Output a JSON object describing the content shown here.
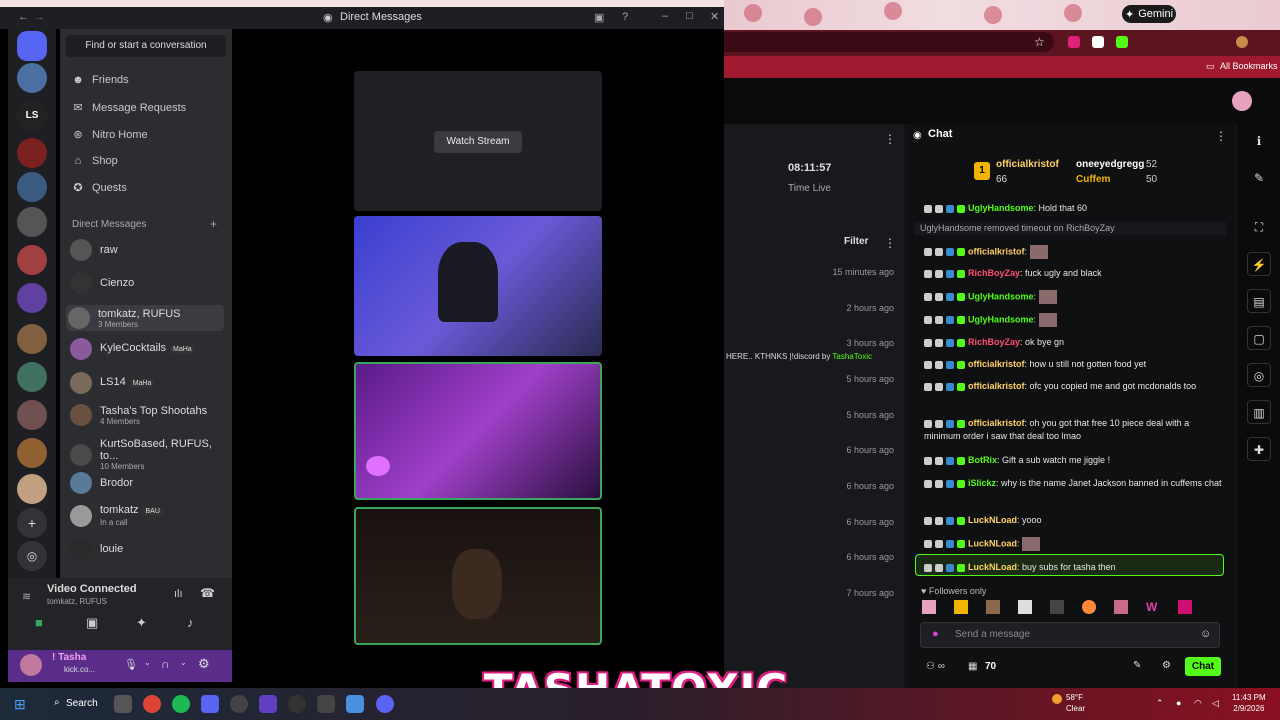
{
  "browser": {
    "gemini_label": "Gemini",
    "bookmarks_label": "All Bookmarks"
  },
  "discord": {
    "title": "Direct Messages",
    "find_placeholder": "Find or start a conversation",
    "nav": [
      {
        "label": "Friends",
        "icon": "friends-icon"
      },
      {
        "label": "Message Requests",
        "icon": "envelope-icon"
      },
      {
        "label": "Nitro Home",
        "icon": "nitro-icon"
      },
      {
        "label": "Shop",
        "icon": "shop-icon"
      },
      {
        "label": "Quests",
        "icon": "quests-icon"
      }
    ],
    "dm_header": "Direct Messages",
    "dms": [
      {
        "name": "raw",
        "sub": "",
        "tag": ""
      },
      {
        "name": "Cienzo",
        "sub": "",
        "tag": ""
      },
      {
        "name": "tomkatz, RUFUS",
        "sub": "3 Members",
        "tag": ""
      },
      {
        "name": "KyleCocktails",
        "sub": "",
        "tag": "MaHa"
      },
      {
        "name": "LS14",
        "sub": "",
        "tag": "MaHa"
      },
      {
        "name": "Tasha's Top Shootahs",
        "sub": "4 Members",
        "tag": ""
      },
      {
        "name": "KurtSoBased, RUFUS, to...",
        "sub": "10 Members",
        "tag": ""
      },
      {
        "name": "Brodor",
        "sub": "",
        "tag": ""
      },
      {
        "name": "tomkatz",
        "sub": "In a call",
        "tag": "BAU"
      },
      {
        "name": "louie",
        "sub": "",
        "tag": ""
      }
    ],
    "voice_status": "Video Connected",
    "voice_channel": "tomkatz, RUFUS",
    "user_name": "! Tasha",
    "user_status": "kick.co...",
    "watch_stream": "Watch Stream"
  },
  "site": {
    "timer": "08:11:57",
    "timer_label": "Time Live",
    "filter_label": "Filter",
    "ago": [
      "15 minutes ago",
      "2 hours ago",
      "3 hours ago",
      "5 hours ago",
      "5 hours ago",
      "6 hours ago",
      "6 hours ago",
      "6 hours ago",
      "6 hours ago",
      "7 hours ago"
    ],
    "banner_text": "HERE.. KTHNKS |!discord by",
    "banner_user": "TashaToxic"
  },
  "chat": {
    "title": "Chat",
    "leaders": {
      "first": {
        "rank": "1",
        "name": "officialkristof",
        "count": "66"
      },
      "second": {
        "name": "oneeyedgregg",
        "count": "52"
      },
      "third": {
        "name": "Cuffem",
        "count": "50"
      }
    },
    "lines": [
      {
        "user": "UglyHandsome",
        "color": "#53fc18",
        "text": "Hold that 60"
      },
      {
        "user": "",
        "color": "#aaa",
        "text": "UglyHandsome removed timeout on RichBoyZay"
      },
      {
        "user": "officialkristof",
        "color": "#ffd166",
        "text": ""
      },
      {
        "user": "RichBoyZay",
        "color": "#ff4d6d",
        "text": "fuck ugly and black"
      },
      {
        "user": "UglyHandsome",
        "color": "#53fc18",
        "text": ""
      },
      {
        "user": "UglyHandsome",
        "color": "#53fc18",
        "text": ""
      },
      {
        "user": "RichBoyZay",
        "color": "#ff4d6d",
        "text": "ok bye gn"
      },
      {
        "user": "officialkristof",
        "color": "#ffd166",
        "text": "how u still not gotten food yet"
      },
      {
        "user": "officialkristof",
        "color": "#ffd166",
        "text": "ofc you copied me and got mcdonalds too"
      },
      {
        "user": "officialkristof",
        "color": "#ffd166",
        "text": "oh you got that free 10 piece deal with a minimum order i saw that deal too lmao"
      },
      {
        "user": "BotRix",
        "color": "#53fc18",
        "text": "Gift a sub watch me jiggle !"
      },
      {
        "user": "iSlickz",
        "color": "#53fc18",
        "text": "why is the name Janet Jackson banned in cuffems chat"
      },
      {
        "user": "LuckNLoad",
        "color": "#ffd166",
        "text": "yooo"
      },
      {
        "user": "LuckNLoad",
        "color": "#ffd166",
        "text": ""
      },
      {
        "user": "LuckNLoad",
        "color": "#ffd166",
        "text": "buy subs for tasha then"
      }
    ],
    "followers_only": "Followers only",
    "send_placeholder": "Send a message",
    "viewer_count": "70",
    "chat_button": "Chat"
  },
  "taskbar": {
    "search": "Search",
    "weather_temp": "58°F",
    "weather_desc": "Clear",
    "time": "11:43 PM",
    "date": "2/9/2026"
  },
  "overlay_text": "TASHATOXIC"
}
